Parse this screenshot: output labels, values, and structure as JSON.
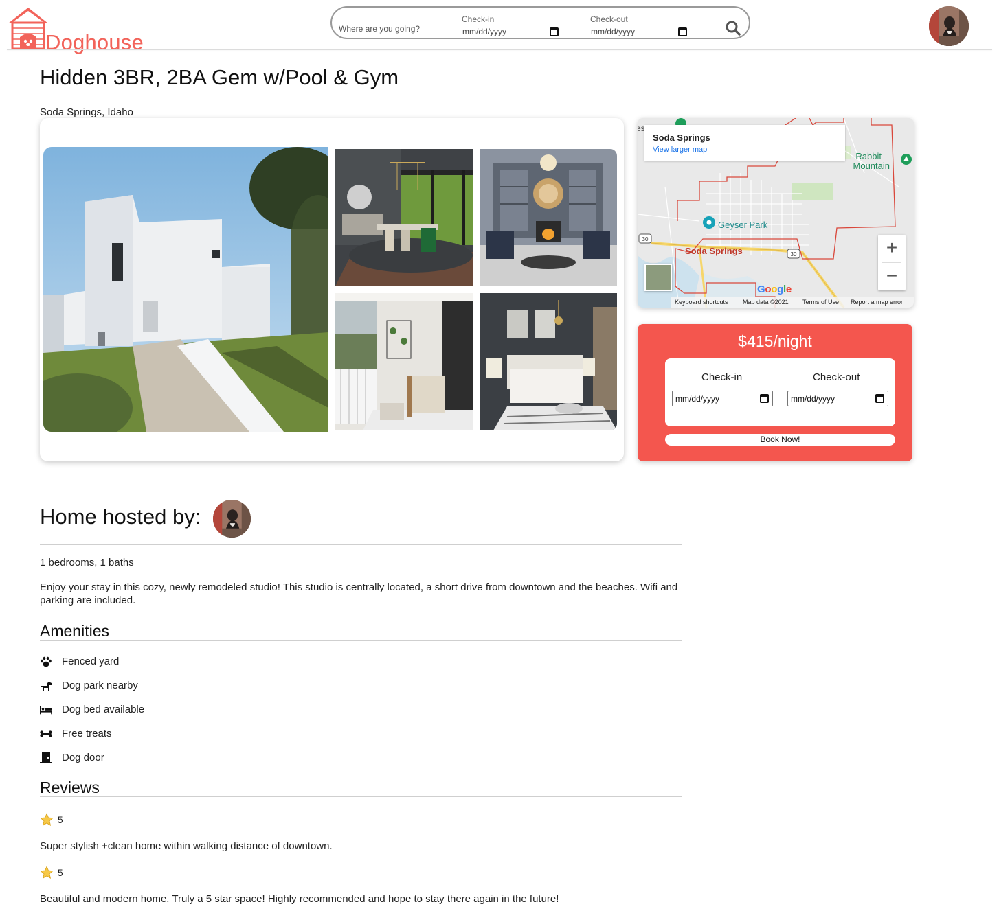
{
  "brand": {
    "name": "Doghouse",
    "color": "#f2635a"
  },
  "search": {
    "where_placeholder": "Where are you going?",
    "checkin_label": "Check-in",
    "checkin_value": "mm/dd/yyyy",
    "checkout_label": "Check-out",
    "checkout_value": "mm/dd/yyyy",
    "icon": "search-icon"
  },
  "listing": {
    "title": "Hidden 3BR, 2BA Gem w/Pool & Gym",
    "location": "Soda Springs, Idaho"
  },
  "map": {
    "place_title": "Soda Springs",
    "larger_map_link": "View larger map",
    "labels": {
      "rabbit_1": "Rabbit",
      "rabbit_2": "Mountain",
      "geyser": "Geyser Park",
      "town": "Soda Springs",
      "route_a": "30",
      "route_b": "30",
      "edge": "es",
      "google": "Google"
    },
    "footer": {
      "shortcuts": "Keyboard shortcuts",
      "data": "Map data ©2021",
      "terms": "Terms of Use",
      "report": "Report a map error"
    },
    "zoom_in": "+",
    "zoom_out": "−"
  },
  "booking": {
    "price": "$415/night",
    "checkin_label": "Check-in",
    "checkin_value": "mm/dd/yyyy",
    "checkout_label": "Check-out",
    "checkout_value": "mm/dd/yyyy",
    "book_label": "Book Now!",
    "accent": "#f4564e"
  },
  "host": {
    "title": "Home hosted by:"
  },
  "details": {
    "bedbath": "1 bedrooms, 1 baths",
    "description": "Enjoy your stay in this cozy, newly remodeled studio! This studio is centrally located, a short drive from downtown and the beaches. Wifi and parking are included."
  },
  "amenities": {
    "heading": "Amenities",
    "items": [
      {
        "label": "Fenced yard",
        "icon": "paw-icon"
      },
      {
        "label": "Dog park nearby",
        "icon": "dog-icon"
      },
      {
        "label": "Dog bed available",
        "icon": "bed-icon"
      },
      {
        "label": "Free treats",
        "icon": "bone-icon"
      },
      {
        "label": "Dog door",
        "icon": "door-icon"
      }
    ]
  },
  "reviews": {
    "heading": "Reviews",
    "items": [
      {
        "rating": "5",
        "text": "Super stylish +clean home within walking distance of downtown."
      },
      {
        "rating": "5",
        "text": "Beautiful and modern home. Truly a 5 star space! Highly recommended and hope to stay there again in the future!"
      }
    ]
  }
}
